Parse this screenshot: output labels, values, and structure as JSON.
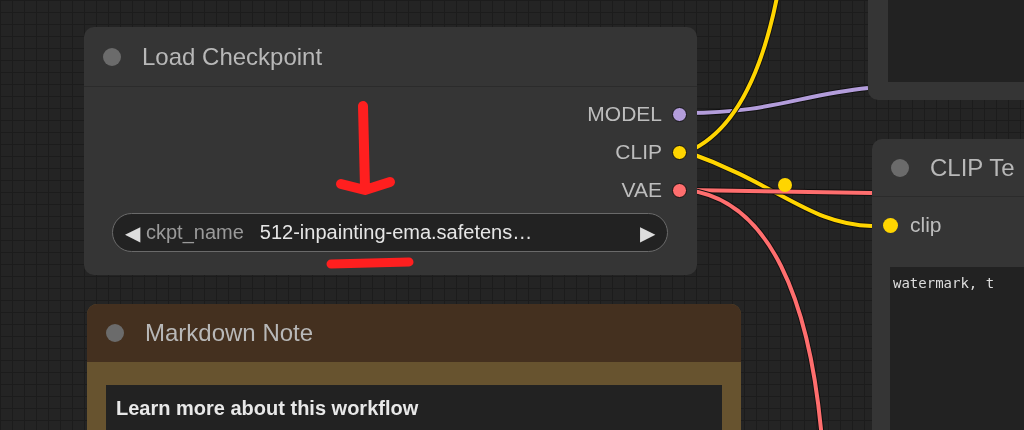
{
  "nodes": [
    {
      "kind": "blank"
    },
    {
      "kind": "loader",
      "title": "Load Checkpoint",
      "outputs": [
        {
          "label": "MODEL",
          "color": "#b39ddb"
        },
        {
          "label": "CLIP",
          "color": "#ffd500"
        },
        {
          "label": "VAE",
          "color": "#ff6e6e"
        }
      ],
      "widget": {
        "prev": "◀",
        "label": "ckpt_name",
        "value": "512-inpainting-ema.safetens…",
        "next": "▶"
      }
    },
    {
      "kind": "encoder",
      "title": "CLIP Te",
      "inputs": [
        {
          "label": "clip",
          "color": "#ffd500"
        }
      ],
      "text": "watermark, t"
    },
    {
      "kind": "note",
      "title": "Markdown Note",
      "heading": "Learn more about this workflow"
    }
  ]
}
